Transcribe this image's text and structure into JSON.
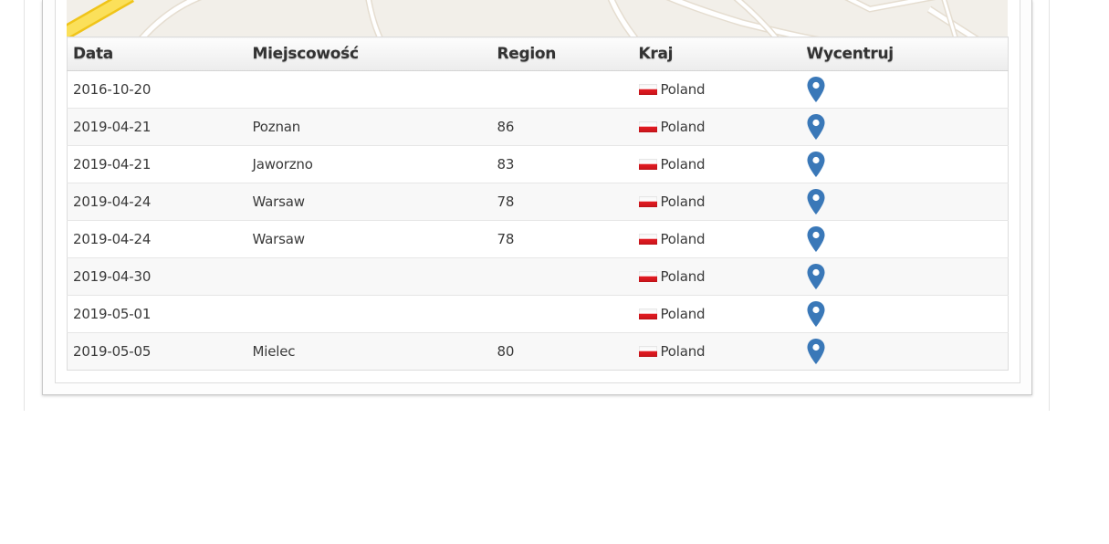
{
  "table": {
    "headers": {
      "date": "Data",
      "city": "Miejscowość",
      "region": "Region",
      "country": "Kraj",
      "center": "Wycentruj"
    },
    "rows": [
      {
        "date": "2016-10-20",
        "city": "",
        "region": "",
        "country": "Poland",
        "flag": "poland-flag-icon",
        "action": "map-pin-icon"
      },
      {
        "date": "2019-04-21",
        "city": "Poznan",
        "region": "86",
        "country": "Poland",
        "flag": "poland-flag-icon",
        "action": "map-pin-icon"
      },
      {
        "date": "2019-04-21",
        "city": "Jaworzno",
        "region": "83",
        "country": "Poland",
        "flag": "poland-flag-icon",
        "action": "map-pin-icon"
      },
      {
        "date": "2019-04-24",
        "city": "Warsaw",
        "region": "78",
        "country": "Poland",
        "flag": "poland-flag-icon",
        "action": "map-pin-icon"
      },
      {
        "date": "2019-04-24",
        "city": "Warsaw",
        "region": "78",
        "country": "Poland",
        "flag": "poland-flag-icon",
        "action": "map-pin-icon"
      },
      {
        "date": "2019-04-30",
        "city": "",
        "region": "",
        "country": "Poland",
        "flag": "poland-flag-icon",
        "action": "map-pin-icon"
      },
      {
        "date": "2019-05-01",
        "city": "",
        "region": "",
        "country": "Poland",
        "flag": "poland-flag-icon",
        "action": "map-pin-icon"
      },
      {
        "date": "2019-05-05",
        "city": "Mielec",
        "region": "80",
        "country": "Poland",
        "flag": "poland-flag-icon",
        "action": "map-pin-icon"
      }
    ]
  },
  "colors": {
    "pin": "#3a78b8",
    "map_background": "#f2efe9",
    "map_road_major": "#f7d91e"
  }
}
